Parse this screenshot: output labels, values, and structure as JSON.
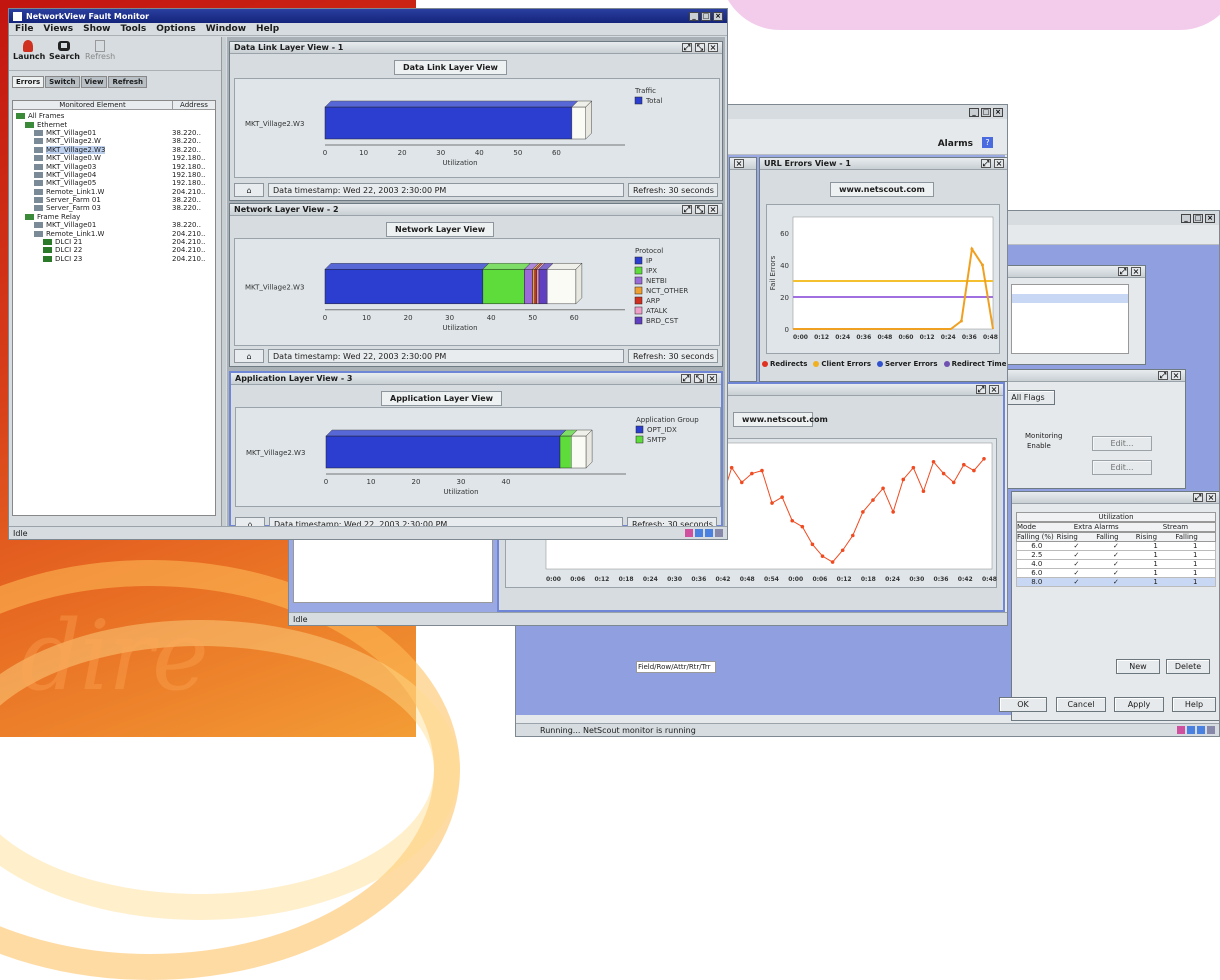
{
  "main_window": {
    "title": "NetworkView Fault Monitor",
    "menus": [
      "File",
      "Views",
      "Show",
      "Tools",
      "Options",
      "Window",
      "Help"
    ],
    "toolbar": [
      {
        "label": "Launch",
        "icon": "launch-icon"
      },
      {
        "label": "Search",
        "icon": "binoculars-icon"
      },
      {
        "label": "Refresh",
        "icon": "refresh-icon"
      }
    ],
    "tabs": [
      "Errors",
      "Switch",
      "View",
      "Refresh"
    ],
    "tree_headers": {
      "element": "Monitored Element",
      "address": "Address"
    },
    "tree": [
      {
        "label": "All Frames",
        "address": "",
        "indent": 0,
        "icon": "folder"
      },
      {
        "label": "Ethernet",
        "address": "",
        "indent": 1,
        "icon": "folder"
      },
      {
        "label": "MKT_Village01",
        "address": "38.220..",
        "indent": 2,
        "icon": "device"
      },
      {
        "label": "MKT_Village2.W",
        "address": "38.220..",
        "indent": 2,
        "icon": "device"
      },
      {
        "label": "MKT_Village2.W3",
        "address": "38.220..",
        "indent": 2,
        "icon": "device",
        "selected": true
      },
      {
        "label": "MKT_Village0.W",
        "address": "192.180..",
        "indent": 2,
        "icon": "device"
      },
      {
        "label": "MKT_Village03",
        "address": "192.180..",
        "indent": 2,
        "icon": "device"
      },
      {
        "label": "MKT_Village04",
        "address": "192.180..",
        "indent": 2,
        "icon": "device"
      },
      {
        "label": "MKT_Village05",
        "address": "192.180..",
        "indent": 2,
        "icon": "device"
      },
      {
        "label": "Remote_Link1.W",
        "address": "204.210..",
        "indent": 2,
        "icon": "device"
      },
      {
        "label": "Server_Farm 01",
        "address": "38.220..",
        "indent": 2,
        "icon": "device"
      },
      {
        "label": "Server_Farm 03",
        "address": "38.220..",
        "indent": 2,
        "icon": "device"
      },
      {
        "label": "Frame Relay",
        "address": "",
        "indent": 1,
        "icon": "folder"
      },
      {
        "label": "MKT_Village01",
        "address": "38.220..",
        "indent": 2,
        "icon": "device"
      },
      {
        "label": "Remote_Link1.W",
        "address": "204.210..",
        "indent": 2,
        "icon": "device"
      },
      {
        "label": "DLCI 21",
        "address": "204.210..",
        "indent": 3,
        "icon": "link"
      },
      {
        "label": "DLCI 22",
        "address": "204.210..",
        "indent": 3,
        "icon": "link"
      },
      {
        "label": "DLCI 23",
        "address": "204.210..",
        "indent": 3,
        "icon": "link"
      }
    ],
    "status": "Idle"
  },
  "view_datalink": {
    "frame_title": "Data Link Layer View - 1",
    "chart_title": "Data Link Layer View",
    "element": "MKT_Village2.W3",
    "xlabel": "Utilization",
    "legend_title": "Traffic",
    "legend": [
      {
        "name": "Total",
        "color": "#2b3ed0"
      }
    ],
    "footer_time": "Data timestamp: Wed 22, 2003 2:30:00 PM",
    "footer_refresh": "Refresh: 30 seconds"
  },
  "view_network": {
    "frame_title": "Network Layer View - 2",
    "chart_title": "Network Layer View",
    "element": "MKT_Village2.W3",
    "xlabel": "Utilization",
    "legend_title": "Protocol",
    "legend": [
      {
        "name": "IP",
        "color": "#2b3ed0"
      },
      {
        "name": "IPX",
        "color": "#5edc3c"
      },
      {
        "name": "NETBI",
        "color": "#9a6ad6"
      },
      {
        "name": "NCT_OTHER",
        "color": "#f0a030"
      },
      {
        "name": "ARP",
        "color": "#d03020"
      },
      {
        "name": "ATALK",
        "color": "#f0a0c8"
      },
      {
        "name": "BRD_CST",
        "color": "#6040c0"
      }
    ],
    "footer_time": "Data timestamp: Wed 22, 2003 2:30:00 PM",
    "footer_refresh": "Refresh: 30 seconds"
  },
  "view_app": {
    "frame_title": "Application Layer View - 3",
    "chart_title": "Application Layer View",
    "element": "MKT_Village2.W3",
    "xlabel": "Utilization",
    "legend_title": "Application Group",
    "legend": [
      {
        "name": "OPT_IDX",
        "color": "#2b3ed0"
      },
      {
        "name": "SMTP",
        "color": "#5edc3c"
      }
    ],
    "footer_time": "Data timestamp: Wed 22, 2003 2:30:00 PM",
    "footer_refresh": "Refresh: 30 seconds"
  },
  "url_window": {
    "menu_item": "Alarms",
    "frame_title": "URL Errors View - 1",
    "url": "www.netscout.com",
    "ylabel": "Fail Errors",
    "xlabels": [
      "0:00",
      "0:12",
      "0:24",
      "0:36",
      "0:48",
      "0:60",
      "0:12",
      "0:24",
      "0:36",
      "0:48"
    ],
    "legend": [
      {
        "name": "Redirects",
        "color": "#e03020"
      },
      {
        "name": "Client Errors",
        "color": "#f0b020"
      },
      {
        "name": "Server Errors",
        "color": "#3050d0"
      },
      {
        "name": "Redirect Time",
        "color": "#7050b0"
      }
    ],
    "status": "Idle"
  },
  "response_frame": {
    "url": "www.netscout.com",
    "xlabels": [
      "0:00",
      "0:06",
      "0:12",
      "0:18",
      "0:24",
      "0:30",
      "0:36",
      "0:42",
      "0:48",
      "0:54",
      "0:00",
      "0:06",
      "0:12",
      "0:18",
      "0:24",
      "0:30",
      "0:36",
      "0:42",
      "0:48"
    ]
  },
  "lower_window": {
    "status": "Running... NetScout monitor is running",
    "buttons": {
      "ok": "OK",
      "cancel": "Cancel",
      "apply": "Apply",
      "help": "Help",
      "new": "New",
      "delete": "Delete"
    },
    "tab_label": "All Flags",
    "monitoring_header": "Monitoring",
    "monitoring_sub": "Enable",
    "edit_btn": "Edit...",
    "field_value": "Field/Row/Attr/Rtr/Trr",
    "table": {
      "group_header": "Utilization",
      "col_groups": [
        "Mode",
        "Extra Alarms",
        "Stream"
      ],
      "columns": [
        "Falling (%)",
        "Rising",
        "Falling",
        "Rising",
        "Falling"
      ],
      "rows": [
        [
          "6.0",
          "✓",
          "✓",
          "1",
          "1"
        ],
        [
          "2.5",
          "✓",
          "✓",
          "1",
          "1"
        ],
        [
          "4.0",
          "✓",
          "✓",
          "1",
          "1"
        ],
        [
          "6.0",
          "✓",
          "✓",
          "1",
          "1"
        ],
        [
          "8.0",
          "✓",
          "✓",
          "1",
          "1"
        ]
      ]
    }
  },
  "colors": {
    "titlebar": "#1e3190",
    "panel": "#d6dcdf",
    "bar_blue": "#2b3ed0",
    "line_orange": "#f04a20"
  },
  "chart_data": [
    {
      "type": "bar",
      "title": "Data Link Layer View",
      "xlabel": "Utilization",
      "categories": [
        "MKT_Village2.W3"
      ],
      "series": [
        {
          "name": "Total",
          "values": [
            64
          ]
        }
      ],
      "xlim": [
        0,
        70
      ],
      "xticks": [
        0,
        10,
        20,
        30,
        40,
        50,
        60
      ]
    },
    {
      "type": "bar",
      "title": "Network Layer View",
      "xlabel": "Utilization",
      "categories": [
        "MKT_Village2.W3"
      ],
      "series": [
        {
          "name": "IP",
          "values": [
            38
          ]
        },
        {
          "name": "IPX",
          "values": [
            10
          ]
        },
        {
          "name": "NETBI",
          "values": [
            2
          ]
        },
        {
          "name": "NCT_OTHER",
          "values": [
            0.5
          ]
        },
        {
          "name": "ARP",
          "values": [
            0.5
          ]
        },
        {
          "name": "ATALK",
          "values": [
            0.5
          ]
        },
        {
          "name": "BRD_CST",
          "values": [
            2
          ]
        }
      ],
      "xlim": [
        0,
        65
      ],
      "xticks": [
        0,
        10,
        20,
        30,
        40,
        50,
        60
      ]
    },
    {
      "type": "bar",
      "title": "Application Layer View",
      "xlabel": "Utilization",
      "categories": [
        "MKT_Village2.W3"
      ],
      "series": [
        {
          "name": "OPT_IDX",
          "values": [
            52
          ]
        },
        {
          "name": "SMTP",
          "values": [
            2.5
          ]
        }
      ],
      "xlim": [
        0,
        60
      ],
      "xticks": [
        0,
        10,
        20,
        30,
        40
      ]
    },
    {
      "type": "line",
      "title": "URL Errors View",
      "ylabel": "Fail Errors",
      "ylim": [
        0,
        70
      ],
      "yticks": [
        0,
        20,
        40,
        60
      ],
      "series": [
        {
          "name": "Redirect Time",
          "values": [
            20,
            20,
            20,
            20,
            20,
            20,
            20,
            20,
            20,
            20,
            20,
            20,
            20,
            20,
            20,
            20,
            20,
            20,
            20,
            20
          ]
        },
        {
          "name": "Client Errors",
          "values": [
            30,
            30,
            30,
            30,
            30,
            30,
            30,
            30,
            30,
            30,
            30,
            30,
            30,
            30,
            30,
            30,
            30,
            30,
            30,
            30
          ]
        },
        {
          "name": "Redirects",
          "values": [
            0,
            0,
            0,
            0,
            0,
            0,
            0,
            0,
            0,
            0,
            0,
            0,
            0,
            0,
            0,
            0,
            5,
            50,
            40,
            0
          ]
        }
      ]
    },
    {
      "type": "line",
      "title": "www.netscout.com",
      "series": [
        {
          "name": "Response",
          "values": [
            60,
            50,
            66,
            62,
            70,
            42,
            52,
            58,
            68,
            40,
            38,
            50,
            72,
            40,
            68,
            60,
            70,
            44,
            66,
            56,
            62,
            64,
            42,
            46,
            30,
            26,
            14,
            6,
            2,
            10,
            20,
            36,
            44,
            52,
            36,
            58,
            66,
            50,
            70,
            62,
            56,
            68,
            64,
            72
          ]
        }
      ],
      "ylim": [
        0,
        80
      ]
    }
  ]
}
